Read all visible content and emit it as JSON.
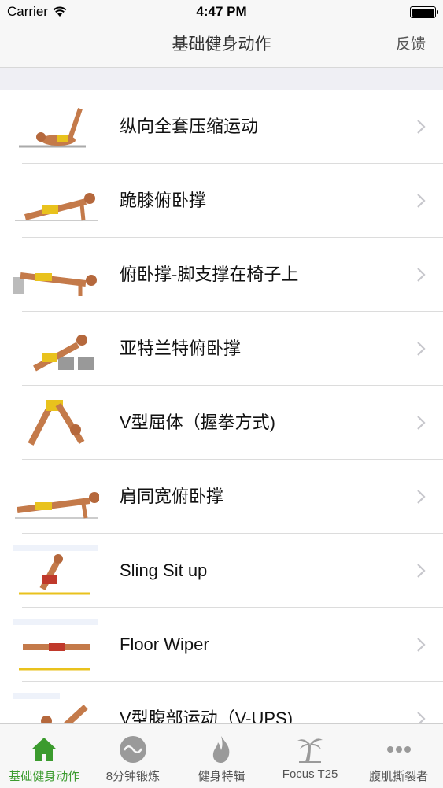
{
  "status_bar": {
    "carrier": "Carrier",
    "time": "4:47 PM"
  },
  "nav": {
    "title": "基础健身动作",
    "right_button": "反馈"
  },
  "rows": [
    {
      "label": "纵向全套压缩运动",
      "thumb_icon": "exercise-figure-icon"
    },
    {
      "label": "跪膝俯卧撑",
      "thumb_icon": "exercise-figure-icon"
    },
    {
      "label": "俯卧撑-脚支撑在椅子上",
      "thumb_icon": "exercise-figure-icon"
    },
    {
      "label": "亚特兰特俯卧撑",
      "thumb_icon": "exercise-figure-icon"
    },
    {
      "label": "V型屈体（握拳方式)",
      "thumb_icon": "exercise-figure-icon"
    },
    {
      "label": "肩同宽俯卧撑",
      "thumb_icon": "exercise-figure-icon"
    },
    {
      "label": "Sling Sit up",
      "thumb_icon": "exercise-figure-icon"
    },
    {
      "label": "Floor Wiper",
      "thumb_icon": "exercise-figure-icon"
    },
    {
      "label": "V型腹部运动（V-UPS)",
      "thumb_icon": "exercise-figure-icon"
    }
  ],
  "tabs": [
    {
      "label": "基础健身动作",
      "icon": "home-icon",
      "active": true
    },
    {
      "label": "8分钟锻炼",
      "icon": "wave-circle-icon",
      "active": false
    },
    {
      "label": "健身特辑",
      "icon": "flame-icon",
      "active": false
    },
    {
      "label": "Focus T25",
      "icon": "palm-tree-icon",
      "active": false
    },
    {
      "label": "腹肌撕裂者",
      "icon": "more-dots-icon",
      "active": false
    }
  ],
  "colors": {
    "accent": "#3b9b2e",
    "inactive_icon": "#9a9a9a",
    "background": "#efeff4"
  }
}
